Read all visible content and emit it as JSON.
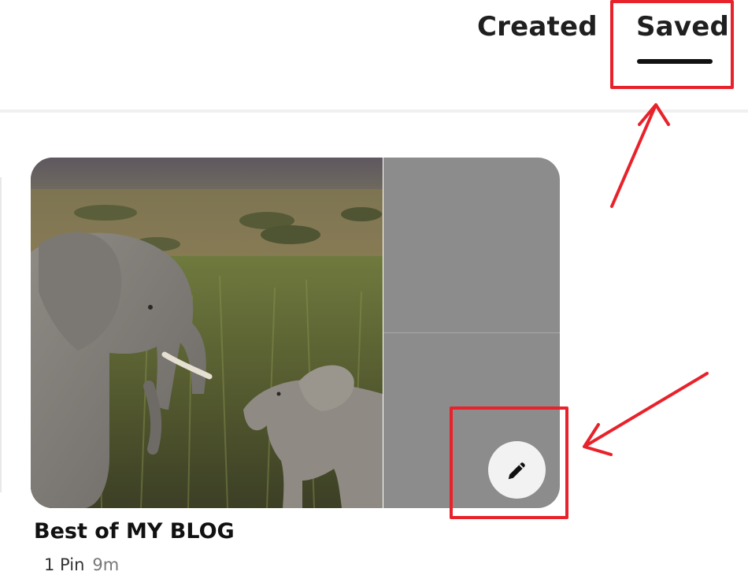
{
  "tabs": [
    {
      "label": "Created",
      "active": false
    },
    {
      "label": "Saved",
      "active": true
    }
  ],
  "board": {
    "title": "Best of MY BLOG",
    "pin_count": "1 Pin",
    "age": "9m"
  },
  "icons": {
    "edit": "pencil-icon"
  },
  "colors": {
    "annotation": "#e8222a",
    "tab_underline": "#111111",
    "cover_placeholder": "#8c8c8c",
    "edit_button_bg": "#f2f2f2"
  }
}
